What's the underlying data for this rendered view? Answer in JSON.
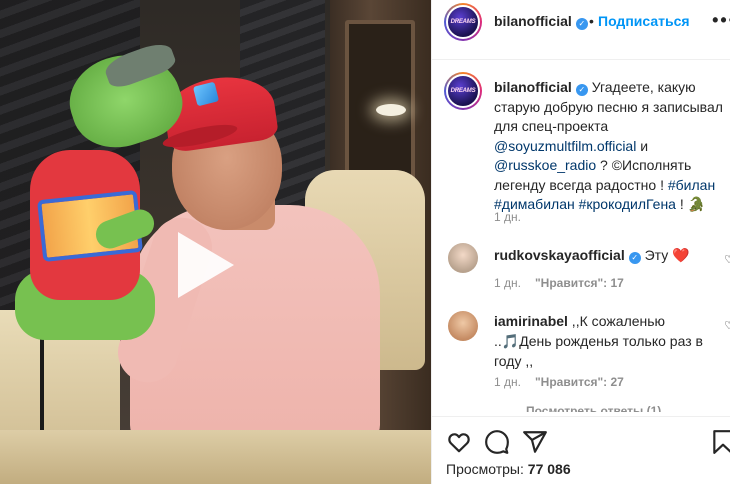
{
  "video": {
    "play_icon": "play-icon"
  },
  "header": {
    "avatar_text": "DREAMS",
    "username": "bilanofficial",
    "verified_icon": "verified-badge-icon",
    "separator": "•",
    "follow_label": "Подписаться",
    "more_icon": "more-options-icon"
  },
  "caption": {
    "username": "bilanofficial",
    "text_1": "Угадеете, какую старую добрую песню я записывал для спец-проекта ",
    "mention_1": "@soyuzmultfilm.official",
    "text_2": " и ",
    "mention_2": "@russkoe_radio",
    "text_3": " ? ©Исполнять легенду всегда радостно ! ",
    "hashtag_1": "#билан",
    "hashtag_2": "#димабилан",
    "hashtag_3": "#крокодилГена",
    "text_4": " ! ",
    "emoji": "🐊",
    "age": "1 дн."
  },
  "comments": [
    {
      "username": "rudkovskayaofficial",
      "verified": true,
      "text": " Эту ",
      "emoji": "❤️",
      "age": "1 дн.",
      "likes": "\"Нравится\": 17"
    },
    {
      "username": "iamirinabel",
      "verified": false,
      "text": " ,,К сожаленью ..🎵День рожденья только раз в году ,,",
      "age": "1 дн.",
      "likes": "\"Нравится\": 27"
    }
  ],
  "view_replies": "Посмотреть ответы (1)",
  "actions": {
    "like_icon": "heart-icon",
    "comment_icon": "comment-icon",
    "share_icon": "share-icon",
    "save_icon": "bookmark-icon"
  },
  "views": {
    "label": "Просмотры:",
    "count": "77 086"
  }
}
